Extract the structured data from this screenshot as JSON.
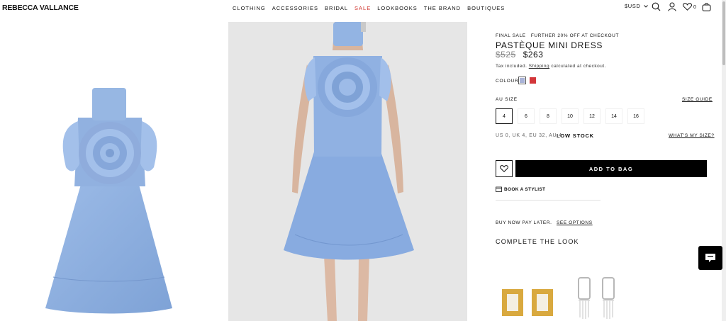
{
  "header": {
    "logo": "REBECCA VALLANCE",
    "nav": [
      "CLOTHING",
      "ACCESSORIES",
      "BRIDAL",
      "SALE",
      "LOOKBOOKS",
      "THE BRAND",
      "BOUTIQUES"
    ],
    "currency": "$USD",
    "wishlist_count": "0"
  },
  "product": {
    "promo": "FINAL SALE   FURTHER 20% OFF AT CHECKOUT",
    "title": "PASTÈQUE MINI DRESS",
    "old_price": "$525",
    "new_price": "$263",
    "tax_prefix": "Tax included.",
    "tax_link": "Shipping",
    "tax_suffix": "calculated at checkout.",
    "colour_label": "COLOUR",
    "colours": [
      "#a9b3d8",
      "#d3373a"
    ],
    "size_label": "AU SIZE",
    "size_guide": "SIZE GUIDE",
    "sizes": [
      "4",
      "6",
      "8",
      "10",
      "12",
      "14",
      "16"
    ],
    "selected_size": "4",
    "conversion": "US 0, UK 4, EU 32, AU 4",
    "stock": "LOW STOCK",
    "whats_my_size": "WHAT'S MY SIZE?",
    "add_to_bag": "ADD TO BAG",
    "book_stylist": "BOOK A STYLIST",
    "bnpl_text": "BUY NOW PAY LATER.",
    "bnpl_link": "SEE OPTIONS",
    "complete_look": "COMPLETE THE LOOK"
  },
  "colors": {
    "accent_sale": "#d0322b",
    "dress_blue": "#8fb0df",
    "button_black": "#000000"
  }
}
